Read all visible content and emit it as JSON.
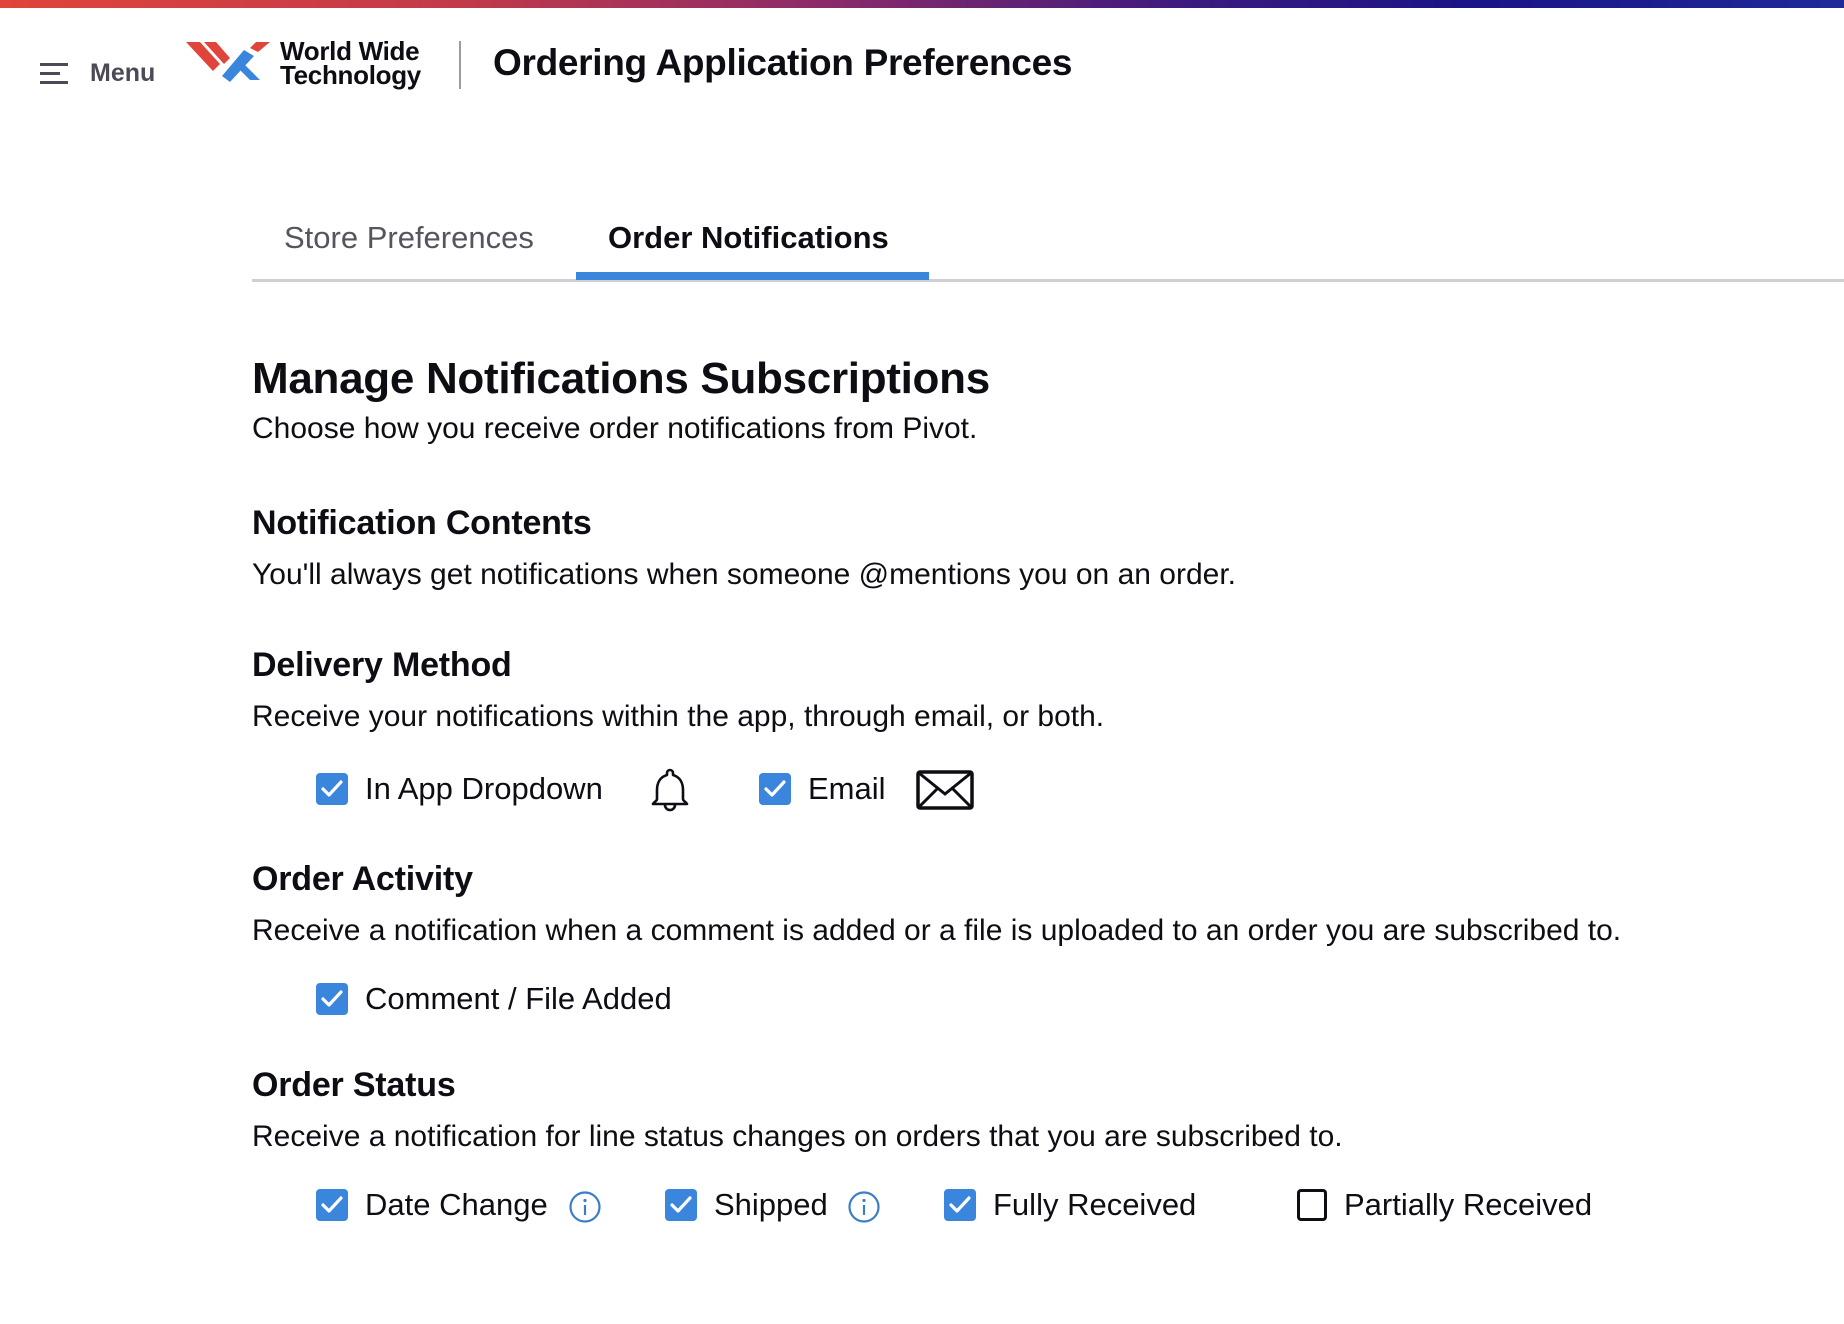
{
  "header": {
    "menu_label": "Menu",
    "logo_line1": "World Wide",
    "logo_line2": "Technology",
    "title": "Ordering Application Preferences"
  },
  "colors": {
    "accent": "#3b86dd",
    "logo_red": "#e0443a",
    "logo_blue": "#3b86dd",
    "text": "#0d0d14",
    "muted": "#55555f"
  },
  "tabs": [
    {
      "label": "Store Preferences",
      "active": false
    },
    {
      "label": "Order Notifications",
      "active": true
    }
  ],
  "main": {
    "heading": "Manage Notifications Subscriptions",
    "subheading": "Choose how you receive order notifications from Pivot."
  },
  "sections": {
    "contents": {
      "title": "Notification Contents",
      "description": "You'll always get notifications when someone @mentions you on an order."
    },
    "delivery": {
      "title": "Delivery Method",
      "description": "Receive your notifications within the app, through email, or both.",
      "options": [
        {
          "label": "In App Dropdown",
          "checked": true,
          "icon": "bell-icon"
        },
        {
          "label": "Email",
          "checked": true,
          "icon": "envelope-icon"
        }
      ]
    },
    "activity": {
      "title": "Order Activity",
      "description": "Receive a notification when a comment is added or a file is uploaded to an order you are subscribed to.",
      "options": [
        {
          "label": "Comment / File Added",
          "checked": true
        }
      ]
    },
    "status": {
      "title": "Order Status",
      "description": "Receive a notification for line status changes on orders that you are subscribed to.",
      "options": [
        {
          "label": "Date Change",
          "checked": true,
          "icon": "info-icon"
        },
        {
          "label": "Shipped",
          "checked": true,
          "icon": "info-icon"
        },
        {
          "label": "Fully Received",
          "checked": true
        },
        {
          "label": "Partially Received",
          "checked": false
        }
      ]
    }
  }
}
